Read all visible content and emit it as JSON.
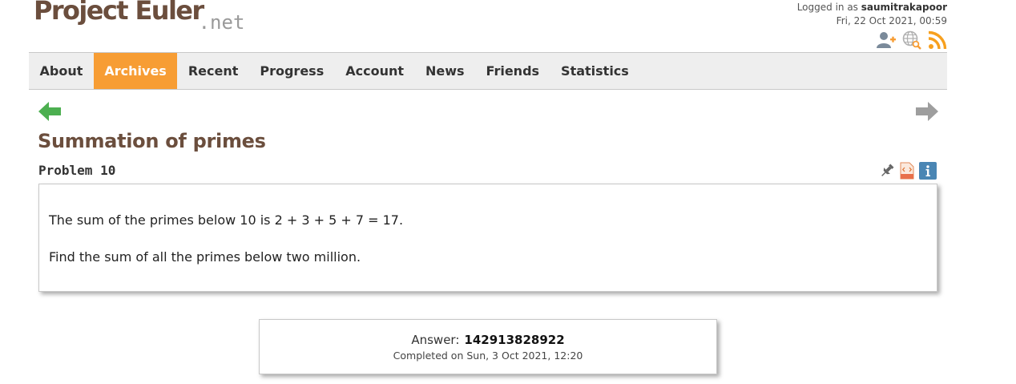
{
  "header": {
    "logo_main": "Project Euler",
    "logo_suffix": ".net",
    "logged_in_prefix": "Logged in as",
    "username": "saumitrakapoor",
    "datetime": "Fri, 22 Oct 2021, 00:59",
    "icons": [
      "add-friend-icon",
      "globe-search-icon",
      "rss-icon"
    ]
  },
  "nav": {
    "items": [
      {
        "label": "About",
        "active": false
      },
      {
        "label": "Archives",
        "active": true
      },
      {
        "label": "Recent",
        "active": false
      },
      {
        "label": "Progress",
        "active": false
      },
      {
        "label": "Account",
        "active": false
      },
      {
        "label": "News",
        "active": false
      },
      {
        "label": "Friends",
        "active": false
      },
      {
        "label": "Statistics",
        "active": false
      }
    ],
    "active_color": "#f79d34"
  },
  "problem": {
    "title": "Summation of primes",
    "number_label": "Problem 10",
    "paragraph_1": "The sum of the primes below 10 is 2 + 3 + 5 + 7 = 17.",
    "paragraph_2": "Find the sum of all the primes below two million."
  },
  "answer": {
    "label": "Answer:",
    "value": "142913828922",
    "completed": "Completed on Sun, 3 Oct 2021, 12:20"
  },
  "colors": {
    "brand_brown": "#6b4e3d",
    "accent_orange": "#f79d34",
    "arrow_green": "#4caf50",
    "arrow_grey": "#9e9e9e",
    "info_blue": "#4a86b4"
  }
}
